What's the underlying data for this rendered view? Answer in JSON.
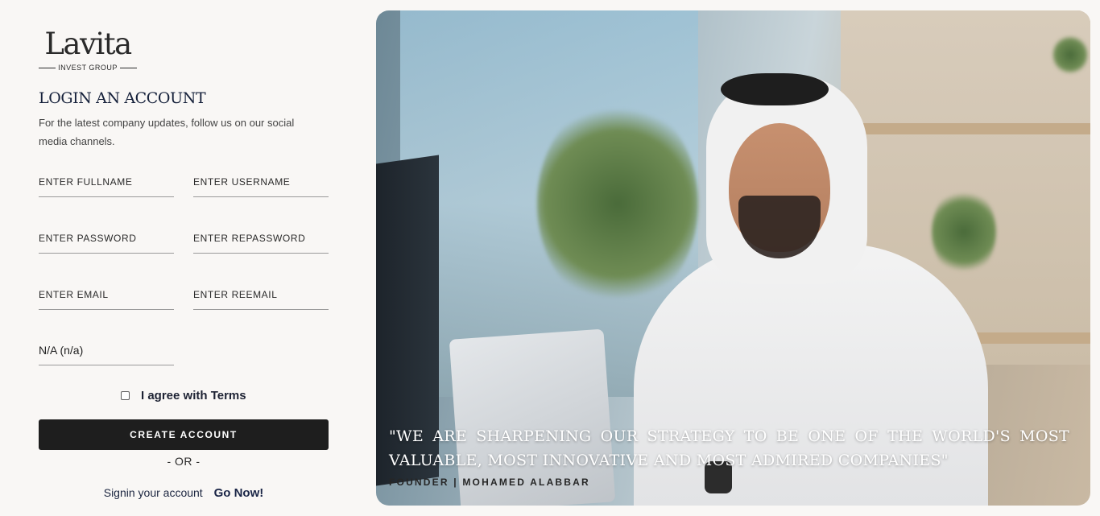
{
  "brand": {
    "name": "Lavita",
    "tagline": "INVEST GROUP"
  },
  "form": {
    "title": "LOGIN AN ACCOUNT",
    "subtitle": "For the latest company updates, follow us on our social media channels.",
    "fields": {
      "fullname": {
        "placeholder": "ENTER FULLNAME",
        "value": ""
      },
      "username": {
        "placeholder": "ENTER USERNAME",
        "value": ""
      },
      "password": {
        "placeholder": "ENTER PASSWORD",
        "value": ""
      },
      "repassword": {
        "placeholder": "ENTER REPASSWORD",
        "value": ""
      },
      "email": {
        "placeholder": "ENTER EMAIL",
        "value": ""
      },
      "reemail": {
        "placeholder": "ENTER REEMAIL",
        "value": ""
      },
      "select": {
        "selected": "N/A (n/a)"
      }
    },
    "agree_label": "I agree with Terms",
    "agree_checked": false,
    "create_button": "CREATE ACCOUNT",
    "or_text": "- OR -",
    "signin_text": "Signin your account",
    "signin_link": "Go Now!"
  },
  "hero": {
    "quote": "\"WE ARE SHARPENING OUR STRATEGY TO BE ONE OF THE WORLD'S MOST VALUABLE, MOST INNOVATIVE AND MOST ADMIRED COMPANIES\"",
    "attribution": "FOUNDER | MOHAMED ALABBAR"
  },
  "colors": {
    "background": "#f9f7f5",
    "title": "#15203a",
    "button": "#1e1e1e",
    "button_text": "#ffffff"
  }
}
